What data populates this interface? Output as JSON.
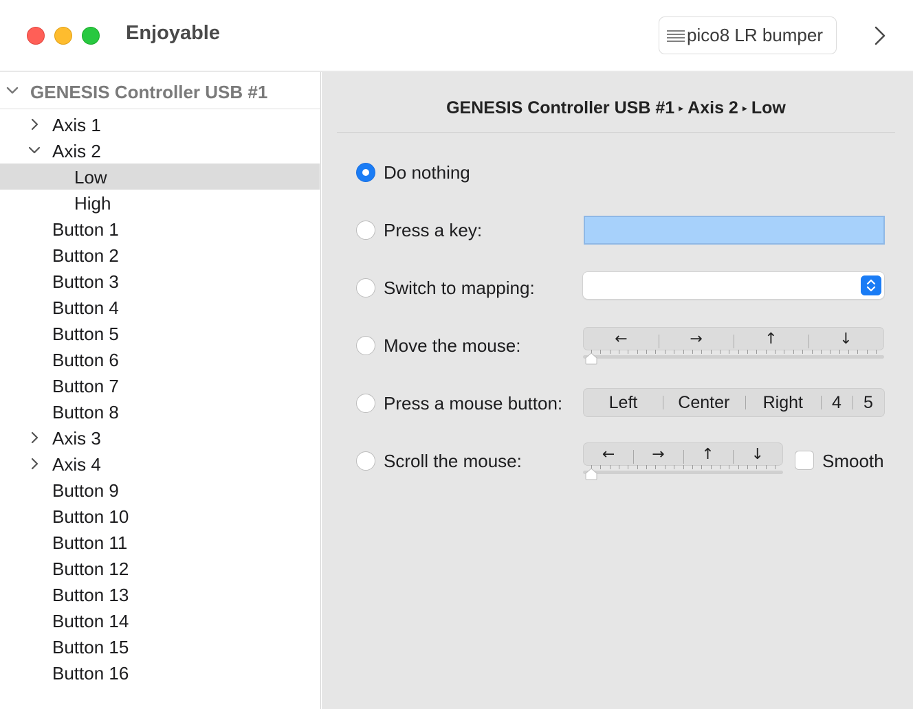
{
  "window": {
    "title": "Enjoyable",
    "mapping_name": "pico8 LR bumper"
  },
  "sidebar": {
    "group_title": "GENESIS Controller USB #1",
    "items": [
      {
        "label": "Axis 1",
        "chevron": "right"
      },
      {
        "label": "Axis 2",
        "chevron": "down"
      },
      {
        "label": "Low"
      },
      {
        "label": "High"
      },
      {
        "label": "Button 1"
      },
      {
        "label": "Button 2"
      },
      {
        "label": "Button 3"
      },
      {
        "label": "Button 4"
      },
      {
        "label": "Button 5"
      },
      {
        "label": "Button 6"
      },
      {
        "label": "Button 7"
      },
      {
        "label": "Button 8"
      },
      {
        "label": "Axis 3",
        "chevron": "right"
      },
      {
        "label": "Axis 4",
        "chevron": "right"
      },
      {
        "label": "Button 9"
      },
      {
        "label": "Button 10"
      },
      {
        "label": "Button 11"
      },
      {
        "label": "Button 12"
      },
      {
        "label": "Button 13"
      },
      {
        "label": "Button 14"
      },
      {
        "label": "Button 15"
      },
      {
        "label": "Button 16"
      }
    ],
    "selected": "Low"
  },
  "breadcrumb": {
    "parts": [
      "GENESIS Controller USB #1",
      "Axis 2",
      "Low"
    ],
    "separator": "▸"
  },
  "options": {
    "do_nothing": "Do nothing",
    "press_key": "Press a key:",
    "switch_mapping": "Switch to mapping:",
    "move_mouse": "Move the mouse:",
    "press_mouse_button": "Press a mouse button:",
    "scroll_mouse": "Scroll the mouse:",
    "selected": "Do nothing"
  },
  "move_directions": [
    "←",
    "→",
    "↑",
    "↓"
  ],
  "scroll_directions": [
    "←",
    "→",
    "↑",
    "↓"
  ],
  "mouse_buttons": [
    "Left",
    "Center",
    "Right",
    "4",
    "5"
  ],
  "smooth_label": "Smooth",
  "smooth_checked": false,
  "colors": {
    "accent": "#1a7cf5",
    "key_field": "#a7d1fb",
    "selection": "#dcdcdc"
  }
}
